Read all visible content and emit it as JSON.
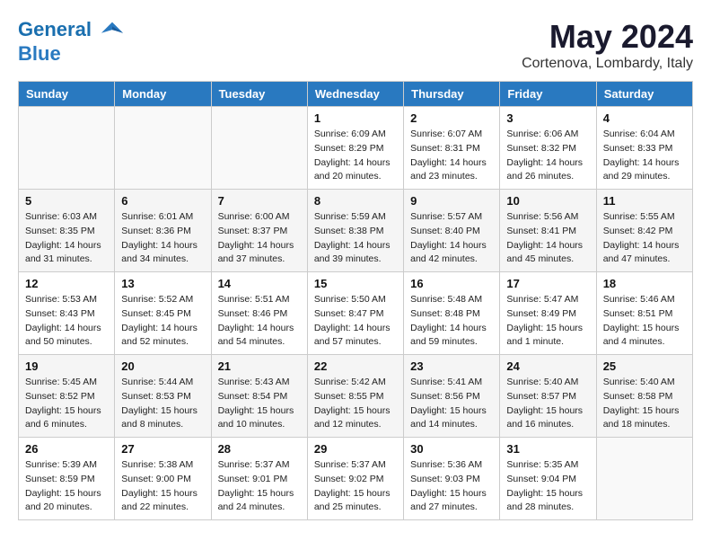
{
  "header": {
    "logo_line1": "General",
    "logo_line2": "Blue",
    "month": "May 2024",
    "location": "Cortenova, Lombardy, Italy"
  },
  "weekdays": [
    "Sunday",
    "Monday",
    "Tuesday",
    "Wednesday",
    "Thursday",
    "Friday",
    "Saturday"
  ],
  "weeks": [
    [
      {
        "day": "",
        "info": ""
      },
      {
        "day": "",
        "info": ""
      },
      {
        "day": "",
        "info": ""
      },
      {
        "day": "1",
        "info": "Sunrise: 6:09 AM\nSunset: 8:29 PM\nDaylight: 14 hours\nand 20 minutes."
      },
      {
        "day": "2",
        "info": "Sunrise: 6:07 AM\nSunset: 8:31 PM\nDaylight: 14 hours\nand 23 minutes."
      },
      {
        "day": "3",
        "info": "Sunrise: 6:06 AM\nSunset: 8:32 PM\nDaylight: 14 hours\nand 26 minutes."
      },
      {
        "day": "4",
        "info": "Sunrise: 6:04 AM\nSunset: 8:33 PM\nDaylight: 14 hours\nand 29 minutes."
      }
    ],
    [
      {
        "day": "5",
        "info": "Sunrise: 6:03 AM\nSunset: 8:35 PM\nDaylight: 14 hours\nand 31 minutes."
      },
      {
        "day": "6",
        "info": "Sunrise: 6:01 AM\nSunset: 8:36 PM\nDaylight: 14 hours\nand 34 minutes."
      },
      {
        "day": "7",
        "info": "Sunrise: 6:00 AM\nSunset: 8:37 PM\nDaylight: 14 hours\nand 37 minutes."
      },
      {
        "day": "8",
        "info": "Sunrise: 5:59 AM\nSunset: 8:38 PM\nDaylight: 14 hours\nand 39 minutes."
      },
      {
        "day": "9",
        "info": "Sunrise: 5:57 AM\nSunset: 8:40 PM\nDaylight: 14 hours\nand 42 minutes."
      },
      {
        "day": "10",
        "info": "Sunrise: 5:56 AM\nSunset: 8:41 PM\nDaylight: 14 hours\nand 45 minutes."
      },
      {
        "day": "11",
        "info": "Sunrise: 5:55 AM\nSunset: 8:42 PM\nDaylight: 14 hours\nand 47 minutes."
      }
    ],
    [
      {
        "day": "12",
        "info": "Sunrise: 5:53 AM\nSunset: 8:43 PM\nDaylight: 14 hours\nand 50 minutes."
      },
      {
        "day": "13",
        "info": "Sunrise: 5:52 AM\nSunset: 8:45 PM\nDaylight: 14 hours\nand 52 minutes."
      },
      {
        "day": "14",
        "info": "Sunrise: 5:51 AM\nSunset: 8:46 PM\nDaylight: 14 hours\nand 54 minutes."
      },
      {
        "day": "15",
        "info": "Sunrise: 5:50 AM\nSunset: 8:47 PM\nDaylight: 14 hours\nand 57 minutes."
      },
      {
        "day": "16",
        "info": "Sunrise: 5:48 AM\nSunset: 8:48 PM\nDaylight: 14 hours\nand 59 minutes."
      },
      {
        "day": "17",
        "info": "Sunrise: 5:47 AM\nSunset: 8:49 PM\nDaylight: 15 hours\nand 1 minute."
      },
      {
        "day": "18",
        "info": "Sunrise: 5:46 AM\nSunset: 8:51 PM\nDaylight: 15 hours\nand 4 minutes."
      }
    ],
    [
      {
        "day": "19",
        "info": "Sunrise: 5:45 AM\nSunset: 8:52 PM\nDaylight: 15 hours\nand 6 minutes."
      },
      {
        "day": "20",
        "info": "Sunrise: 5:44 AM\nSunset: 8:53 PM\nDaylight: 15 hours\nand 8 minutes."
      },
      {
        "day": "21",
        "info": "Sunrise: 5:43 AM\nSunset: 8:54 PM\nDaylight: 15 hours\nand 10 minutes."
      },
      {
        "day": "22",
        "info": "Sunrise: 5:42 AM\nSunset: 8:55 PM\nDaylight: 15 hours\nand 12 minutes."
      },
      {
        "day": "23",
        "info": "Sunrise: 5:41 AM\nSunset: 8:56 PM\nDaylight: 15 hours\nand 14 minutes."
      },
      {
        "day": "24",
        "info": "Sunrise: 5:40 AM\nSunset: 8:57 PM\nDaylight: 15 hours\nand 16 minutes."
      },
      {
        "day": "25",
        "info": "Sunrise: 5:40 AM\nSunset: 8:58 PM\nDaylight: 15 hours\nand 18 minutes."
      }
    ],
    [
      {
        "day": "26",
        "info": "Sunrise: 5:39 AM\nSunset: 8:59 PM\nDaylight: 15 hours\nand 20 minutes."
      },
      {
        "day": "27",
        "info": "Sunrise: 5:38 AM\nSunset: 9:00 PM\nDaylight: 15 hours\nand 22 minutes."
      },
      {
        "day": "28",
        "info": "Sunrise: 5:37 AM\nSunset: 9:01 PM\nDaylight: 15 hours\nand 24 minutes."
      },
      {
        "day": "29",
        "info": "Sunrise: 5:37 AM\nSunset: 9:02 PM\nDaylight: 15 hours\nand 25 minutes."
      },
      {
        "day": "30",
        "info": "Sunrise: 5:36 AM\nSunset: 9:03 PM\nDaylight: 15 hours\nand 27 minutes."
      },
      {
        "day": "31",
        "info": "Sunrise: 5:35 AM\nSunset: 9:04 PM\nDaylight: 15 hours\nand 28 minutes."
      },
      {
        "day": "",
        "info": ""
      }
    ]
  ]
}
